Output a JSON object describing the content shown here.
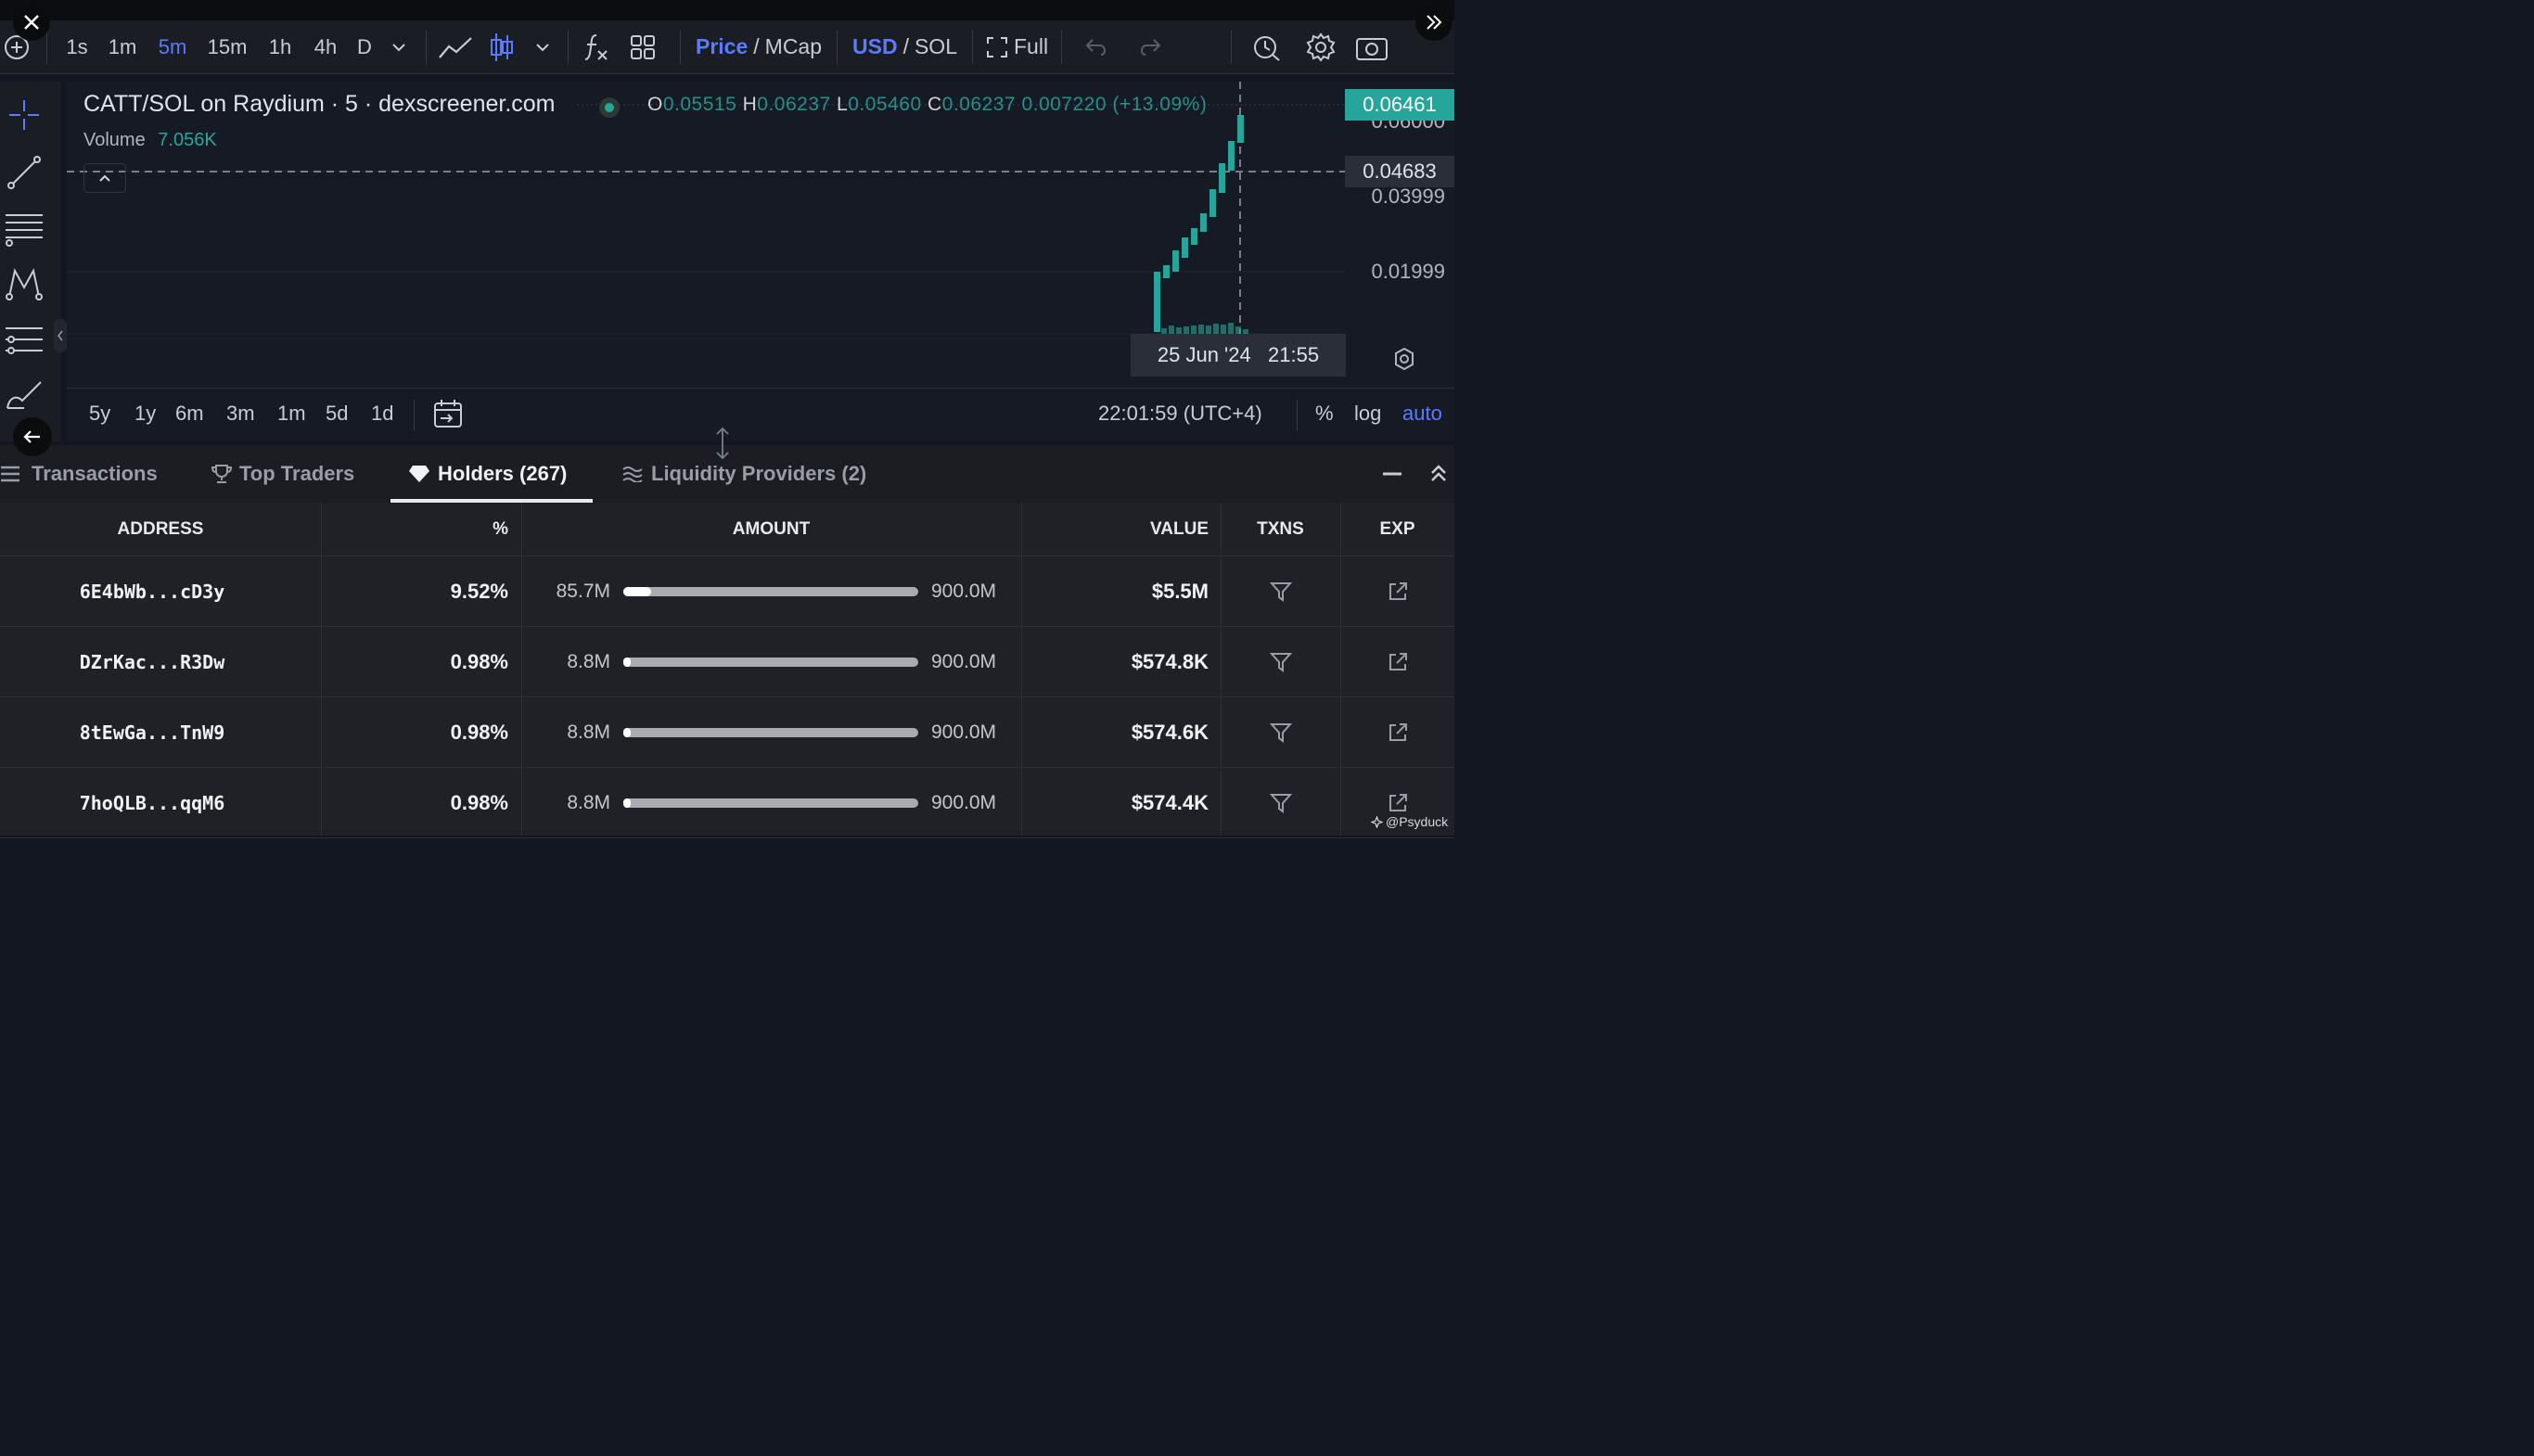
{
  "toolbar": {
    "intervals": [
      "1s",
      "1m",
      "5m",
      "15m",
      "1h",
      "4h",
      "D"
    ],
    "active_interval": "5m",
    "price_label": "Price",
    "mcap_label": "MCap",
    "usd_label": "USD",
    "sol_label": "SOL",
    "slash": "/",
    "full_label": "Full"
  },
  "chart": {
    "title": "CATT/SOL on Raydium · 5 · dexscreener.com",
    "ohlc": {
      "o_label": "O",
      "o": "0.05515",
      "h_label": "H",
      "h": "0.06237",
      "l_label": "L",
      "l": "0.05460",
      "c_label": "C",
      "c": "0.06237",
      "change": "0.007220 (+13.09%)"
    },
    "volume_label": "Volume",
    "volume_value": "7.056K",
    "price_labels": [
      "0.06000",
      "0.03999",
      "0.01999"
    ],
    "current_price": "0.06461",
    "crosshair_price": "0.04683",
    "crosshair_time": "25 Jun '24   21:55",
    "clock": "22:01:59 (UTC+4)",
    "ranges": [
      "5y",
      "1y",
      "6m",
      "3m",
      "1m",
      "5d",
      "1d"
    ],
    "scale_pct": "%",
    "scale_log": "log",
    "scale_auto": "auto",
    "accent": "#26a69a"
  },
  "tabs": [
    {
      "label": "Transactions"
    },
    {
      "label": "Top Traders"
    },
    {
      "label": "Holders (267)"
    },
    {
      "label": "Liquidity Providers (2)"
    }
  ],
  "table": {
    "headers": {
      "address": "ADDRESS",
      "pct": "%",
      "amount": "AMOUNT",
      "value": "VALUE",
      "txns": "TXNS",
      "exp": "EXP"
    },
    "rows": [
      {
        "address": "6E4bWb...cD3y",
        "pct": "9.52%",
        "amount": "85.7M",
        "total": "900.0M",
        "fill": 0.0952,
        "value": "$5.5M"
      },
      {
        "address": "DZrKac...R3Dw",
        "pct": "0.98%",
        "amount": "8.8M",
        "total": "900.0M",
        "fill": 0.0098,
        "value": "$574.8K"
      },
      {
        "address": "8tEwGa...TnW9",
        "pct": "0.98%",
        "amount": "8.8M",
        "total": "900.0M",
        "fill": 0.0098,
        "value": "$574.6K"
      },
      {
        "address": "7hoQLB...qqM6",
        "pct": "0.98%",
        "amount": "8.8M",
        "total": "900.0M",
        "fill": 0.0098,
        "value": "$574.4K"
      }
    ]
  },
  "watermark": "@Psyduck"
}
